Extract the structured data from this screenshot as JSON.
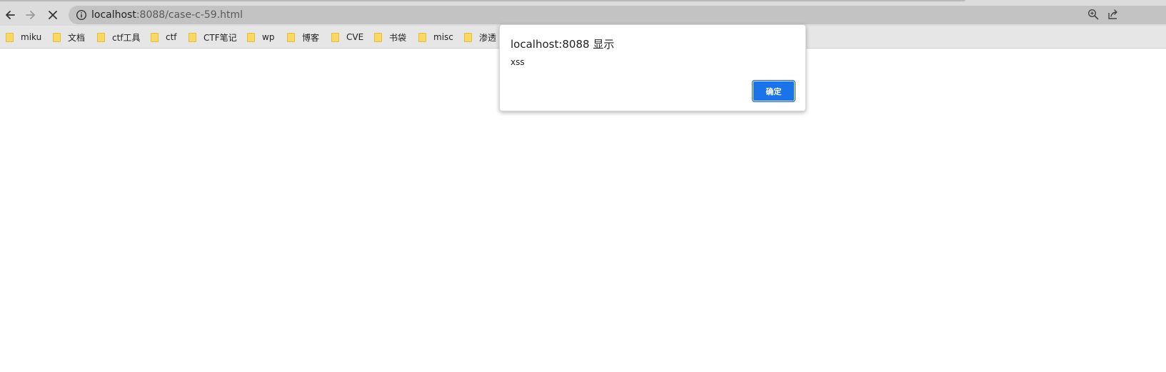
{
  "browser": {
    "address_bar": {
      "host": "localhost",
      "path": ":8088/case-c-59.html"
    },
    "icons": {
      "back": "arrow-left-icon",
      "forward": "arrow-right-icon",
      "stop": "close-icon",
      "site_info": "info-icon",
      "zoom": "zoom-in-icon",
      "share": "share-icon"
    }
  },
  "bookmarks": [
    {
      "label": "miku"
    },
    {
      "label": "文档"
    },
    {
      "label": "ctf工具"
    },
    {
      "label": "ctf"
    },
    {
      "label": "CTF笔记"
    },
    {
      "label": "wp"
    },
    {
      "label": "博客"
    },
    {
      "label": "CVE"
    },
    {
      "label": "书袋"
    },
    {
      "label": "misc"
    },
    {
      "label": "渗透"
    }
  ],
  "dialog": {
    "title": "localhost:8088 显示",
    "message": "xss",
    "ok_label": "确定"
  },
  "colors": {
    "toolbar_bg": "#dcdcdc",
    "omnibox_bg": "#c3c3c3",
    "bookmarks_bg": "#e6e6e6",
    "folder": "#f9d866",
    "button_accent": "#1a73e8"
  }
}
